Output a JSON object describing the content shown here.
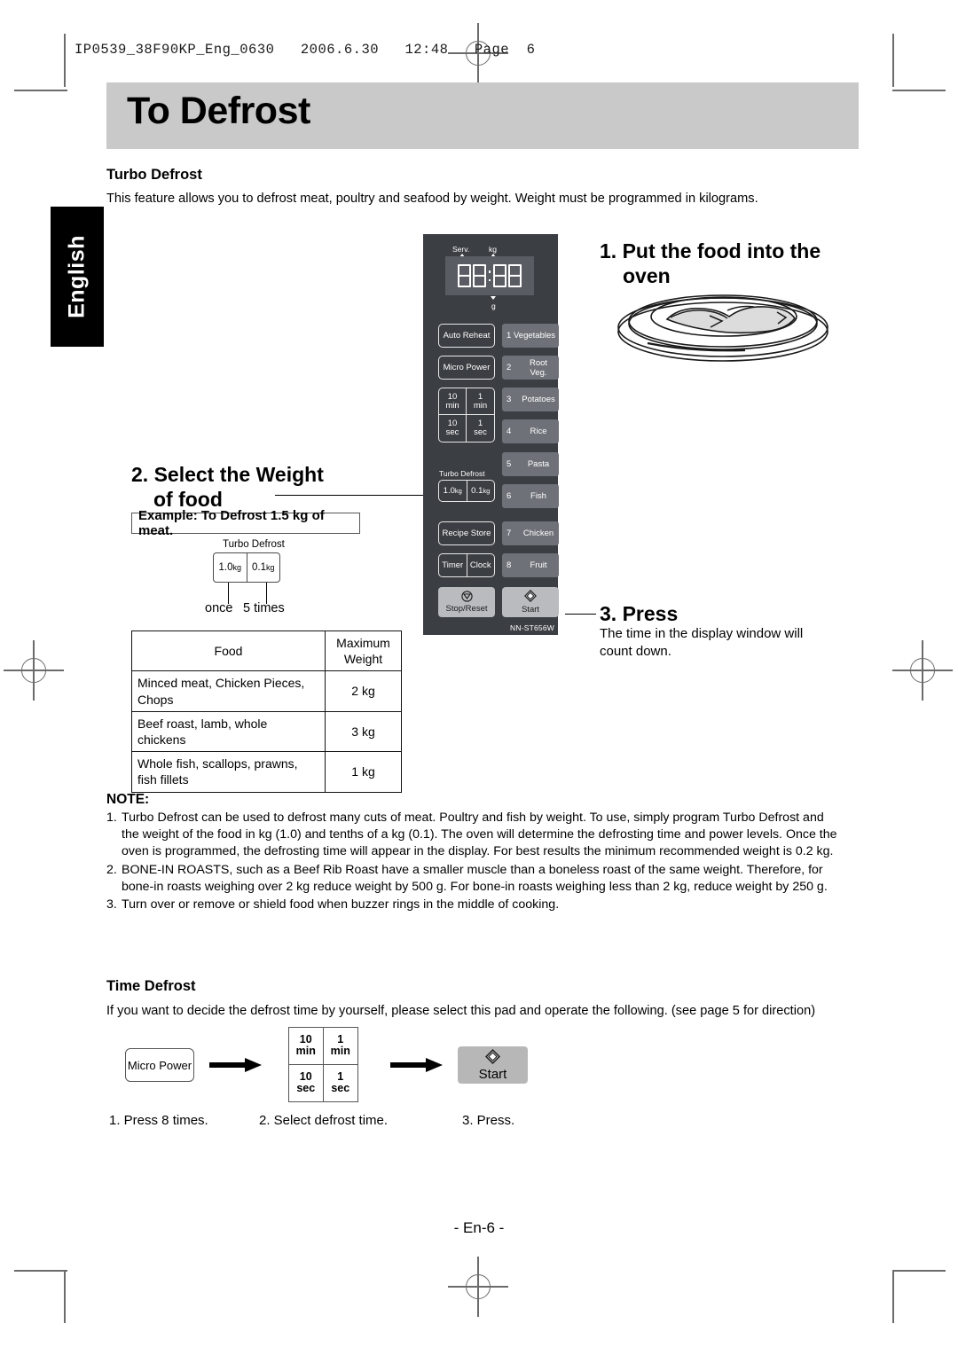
{
  "print_header": "IP0539_38F90KP_Eng_0630   2006.6.30   12:48   Page  6",
  "language_tab": "English",
  "page_title": "To Defrost",
  "turbo_defrost": {
    "heading": "Turbo Defrost",
    "intro": "This feature allows you to defrost meat, poultry and seafood by weight. Weight must be programmed in kilograms."
  },
  "steps": {
    "step1_title": "1. Put the food into the",
    "step1_title_line2": "oven",
    "step2_title": "2. Select the Weight",
    "step2_title_line2": "of food",
    "step3_title": "3. Press",
    "step3_body_line1": "The time in the display window will",
    "step3_body_line2": "count down."
  },
  "example": {
    "box_label": "Example: To Defrost 1.5 kg of meat.",
    "pad_caption": "Turbo Defrost",
    "pad_left": "1.0",
    "pad_left_unit": "kg",
    "pad_right": "0.1",
    "pad_right_unit": "kg",
    "tick_left_label": "once",
    "tick_right_label": "5 times"
  },
  "food_table": {
    "headers": [
      "Food",
      "Maximum Weight"
    ],
    "header_col2_line1": "Maximum",
    "header_col2_line2": "Weight",
    "rows": [
      {
        "food_line1": "Minced meat, Chicken Pieces,",
        "food_line2": "Chops",
        "weight": "2 kg"
      },
      {
        "food_line1": "Beef roast, lamb, whole",
        "food_line2": "chickens",
        "weight": "3 kg"
      },
      {
        "food_line1": "Whole fish, scallops, prawns,",
        "food_line2": "fish fillets",
        "weight": "1 kg"
      }
    ]
  },
  "note": {
    "heading": "NOTE:",
    "items": [
      {
        "num": "1.",
        "text": "Turbo Defrost can be used to defrost many cuts of meat. Poultry and fish by weight. To use, simply program Turbo Defrost and the weight of the food in kg (1.0) and tenths of a kg (0.1). The oven will determine the defrosting time and power levels. Once the oven is programmed, the defrosting time will appear in the display. For best results the minimum recommended weight is 0.2 kg."
      },
      {
        "num": "2.",
        "text": "BONE-IN ROASTS, such as a Beef Rib Roast have a smaller muscle than a boneless roast of the same weight. Therefore, for bone-in roasts weighing over 2 kg reduce weight by 500 g. For bone-in roasts weighing less than 2 kg, reduce weight by 250 g."
      },
      {
        "num": "3.",
        "text": "Turn over or remove or shield food when buzzer rings in the middle of cooking."
      }
    ]
  },
  "time_defrost": {
    "heading": "Time Defrost",
    "intro": "If you want to decide the defrost time by yourself, please select this pad and operate the following. (see page 5 for direction)",
    "pad1_label": "Micro Power",
    "pad2_cells": [
      {
        "top": "10",
        "bottom": "min"
      },
      {
        "top": "1",
        "bottom": "min"
      },
      {
        "top": "10",
        "bottom": "sec"
      },
      {
        "top": "1",
        "bottom": "sec"
      }
    ],
    "pad3_label": "Start",
    "caption1": "1. Press 8 times.",
    "caption2": "2. Select defrost time.",
    "caption3": "3. Press."
  },
  "control_panel": {
    "display_value": "88:88",
    "display_label_serv": "Serv.",
    "display_label_kg": "kg",
    "display_label_g": "g",
    "model": "NN-ST656W",
    "left_buttons": [
      {
        "label": "Auto Reheat"
      },
      {
        "label": "Micro Power"
      }
    ],
    "time_pad": [
      {
        "top": "10",
        "bottom": "min"
      },
      {
        "top": "1",
        "bottom": "min"
      },
      {
        "top": "10",
        "bottom": "sec"
      },
      {
        "top": "1",
        "bottom": "sec"
      }
    ],
    "turbo_caption": "Turbo Defrost",
    "turbo_left": "1.0",
    "turbo_left_unit": "kg",
    "turbo_right": "0.1",
    "turbo_right_unit": "kg",
    "recipe_store": "Recipe Store",
    "timer": "Timer",
    "clock": "Clock",
    "stop_reset": "Stop/Reset",
    "start": "Start",
    "food_buttons": [
      {
        "num": "1",
        "label": "Vegetables"
      },
      {
        "num": "2",
        "label": "Root Veg."
      },
      {
        "num": "3",
        "label": "Potatoes"
      },
      {
        "num": "4",
        "label": "Rice"
      },
      {
        "num": "5",
        "label": "Pasta"
      },
      {
        "num": "6",
        "label": "Fish"
      },
      {
        "num": "7",
        "label": "Chicken"
      },
      {
        "num": "8",
        "label": "Fruit"
      }
    ]
  },
  "footer": "- En-6 -",
  "colors": {
    "title_band": "#c9c9c9",
    "panel_bg": "#3b3e43",
    "panel_food_btn": "#6e7278",
    "panel_action_btn": "#b9bbbe",
    "crop_mark": "#6b6b6b"
  }
}
